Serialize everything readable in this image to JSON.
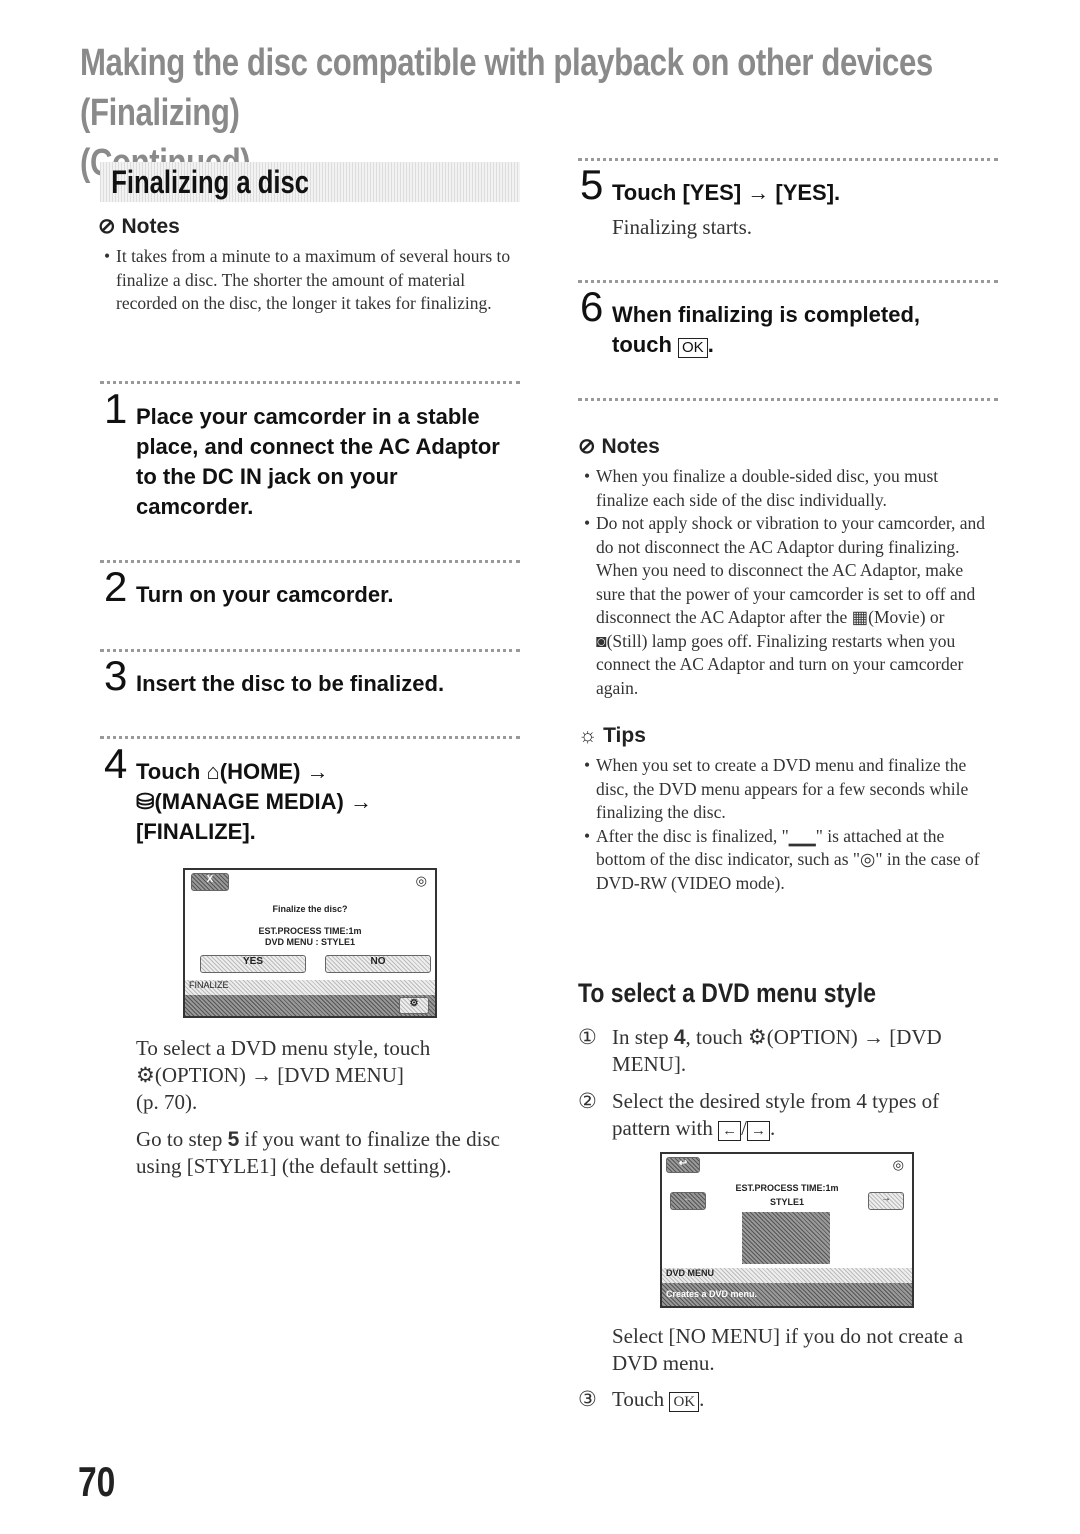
{
  "title": {
    "line1": "Making the disc compatible with playback on other devices (Finalizing)",
    "line2": "(Continued)"
  },
  "section": "Finalizing a disc",
  "left": {
    "notes_heading": "Notes",
    "notes": [
      "It takes from a minute to a maximum of several hours to finalize a disc. The shorter the amount of material recorded on the disc, the longer it takes for finalizing."
    ],
    "steps": [
      {
        "num": "1",
        "text": "Place your camcorder in a stable place, and connect the AC Adaptor to the DC IN jack on your camcorder."
      },
      {
        "num": "2",
        "text": "Turn on your camcorder."
      },
      {
        "num": "3",
        "text": "Insert the disc to be finalized."
      },
      {
        "num": "4",
        "line1": "Touch",
        "home": "(HOME) →",
        "line2": "(MANAGE MEDIA) →",
        "line3": "[FINALIZE]."
      }
    ],
    "screen": {
      "question": "Finalize the disc?",
      "time": "EST.PROCESS TIME:1m",
      "menu": "DVD MENU : STYLE1",
      "yes": "YES",
      "no": "NO",
      "bar": "FINALIZE",
      "close": "X"
    },
    "para1": "To select a DVD menu style, touch",
    "para1b": "(OPTION) → [DVD MENU]",
    "para1c": "(p. 70).",
    "para2_a": "Go to step ",
    "para2_b": "5",
    "para2_c": " if you want to finalize the disc using [STYLE1] (the default setting)."
  },
  "right": {
    "step5": {
      "num": "5",
      "text": "Touch [YES] → [YES].",
      "sub": "Finalizing starts."
    },
    "step6": {
      "num": "6",
      "text": "When finalizing is completed, touch",
      "ok": "OK"
    },
    "notes_heading": "Notes",
    "note1": "When you finalize a double-sided disc, you must finalize each side of the disc individually.",
    "note2a": "Do not apply shock or vibration to your camcorder, and do not disconnect the AC Adaptor during finalizing.",
    "note2b": "When you need to disconnect the AC Adaptor, make sure that the power of your camcorder is set to off and disconnect the AC Adaptor after the",
    "note2c": "(Movie) or",
    "note2d": "(Still) lamp goes off. Finalizing restarts when you connect the AC Adaptor and turn on your camcorder again.",
    "tips_heading": "Tips",
    "tip1": "When you set to create a DVD menu and finalize the disc, the DVD menu appears for a few seconds while finalizing the disc.",
    "tip2a": "After the disc is finalized, \"",
    "tip2b": "\" is attached at the bottom of the disc indicator, such as \"",
    "tip2c": "\" in the case of DVD-RW (VIDEO mode).",
    "subheading": "To select a DVD menu style",
    "items": [
      {
        "num": "①",
        "a": "In step ",
        "b": "4",
        "c": ", touch",
        "d": "(OPTION) → [DVD MENU]."
      },
      {
        "num": "②",
        "text": "Select the desired style from 4 types of pattern with"
      },
      {
        "num": "③",
        "text": "Touch",
        "ok": "OK"
      }
    ],
    "screen": {
      "time": "EST.PROCESS TIME:1m",
      "style": "STYLE1",
      "bar": "DVD MENU",
      "status": "Creates a DVD menu."
    },
    "after_screen": "Select [NO MENU] if you do not create a DVD menu."
  },
  "page_number": "70"
}
